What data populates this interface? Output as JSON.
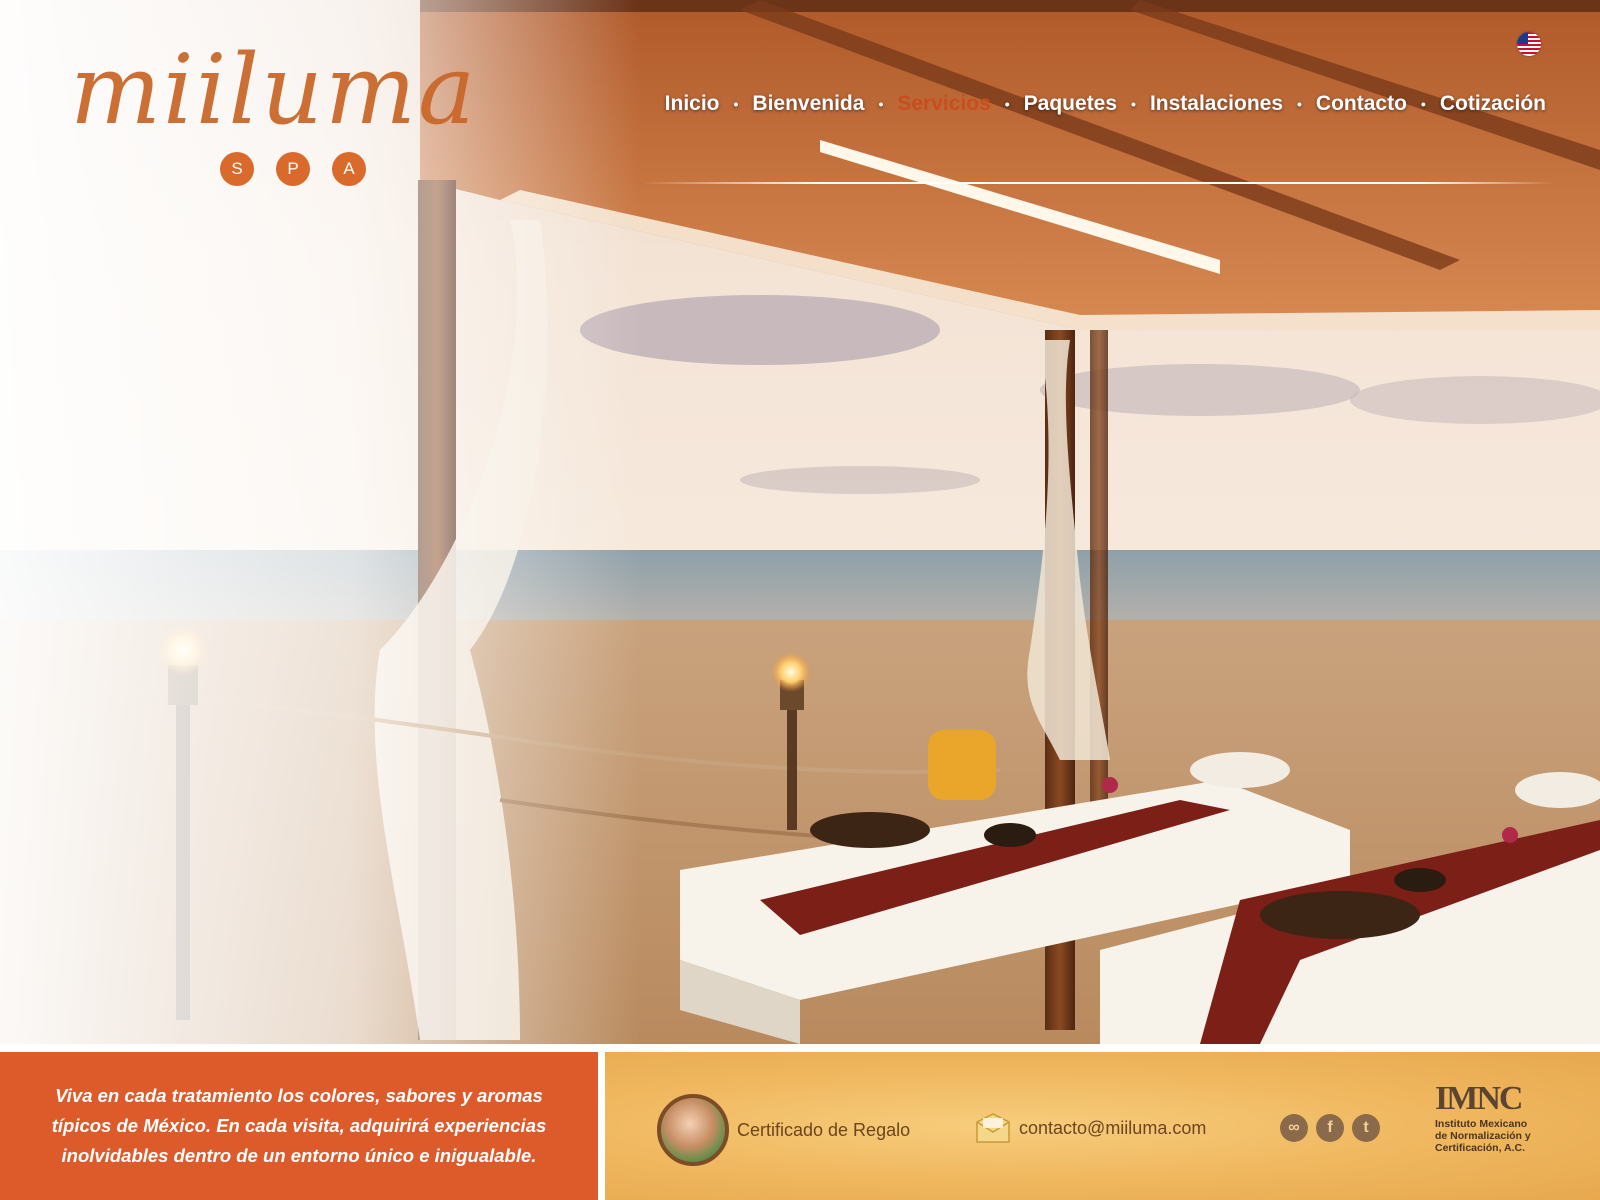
{
  "brand": {
    "name": "miiluma",
    "sub": [
      "S",
      "P",
      "A"
    ]
  },
  "language": {
    "flag": "us-flag-icon"
  },
  "nav": {
    "items": [
      "Inicio",
      "Bienvenida",
      "Servicios",
      "Paquetes",
      "Instalaciones",
      "Contacto",
      "Cotización"
    ],
    "active": "Servicios",
    "separator": "•"
  },
  "footer": {
    "tagline": "Viva en cada tratamiento los colores, sabores y aromas típicos de México. En cada visita, adquirirá experiencias inolvidables dentro de un entorno único e inigualable.",
    "gift_label": "Certificado de Regalo",
    "email": "contacto@miiluma.com",
    "social": [
      {
        "name": "tripadvisor-icon",
        "glyph": "∞"
      },
      {
        "name": "facebook-icon",
        "glyph": "f"
      },
      {
        "name": "twitter-icon",
        "glyph": "t"
      }
    ],
    "cert_logo": "IMNC",
    "cert_text_1": "Instituto Mexicano",
    "cert_text_2": "de Normalización y",
    "cert_text_3": "Certificación, A.C."
  },
  "colors": {
    "accent": "#dd5b2a",
    "active_nav": "#c94d1d",
    "gold": "#f0b860",
    "logo": "#c9682b"
  }
}
